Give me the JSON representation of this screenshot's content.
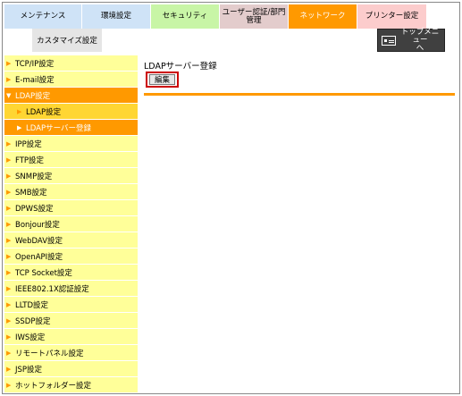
{
  "tabs": {
    "row1": [
      "メンテナンス",
      "環境設定",
      "セキュリティ",
      "ユーザー認証/部門\n管理",
      "ネットワーク",
      "プリンター設定"
    ],
    "row2": [
      "カスタマイズ設定"
    ],
    "top_menu": "トップメニュー\nへ"
  },
  "colors": {
    "accent": "#ff9900",
    "sidebar_bg": "#ffff99",
    "sub_bg": "#ffd633"
  },
  "sidebar": {
    "items": [
      "TCP/IP設定",
      "E-mail設定",
      "LDAP設定",
      "LDAP設定",
      "LDAPサーバー登録",
      "IPP設定",
      "FTP設定",
      "SNMP設定",
      "SMB設定",
      "DPWS設定",
      "Bonjour設定",
      "WebDAV設定",
      "OpenAPI設定",
      "TCP Socket設定",
      "IEEE802.1X認証設定",
      "LLTD設定",
      "SSDP設定",
      "IWS設定",
      "リモートパネル設定",
      "JSP設定",
      "ホットフォルダー設定"
    ]
  },
  "main": {
    "title": "LDAPサーバー登録",
    "edit_label": "編集"
  }
}
